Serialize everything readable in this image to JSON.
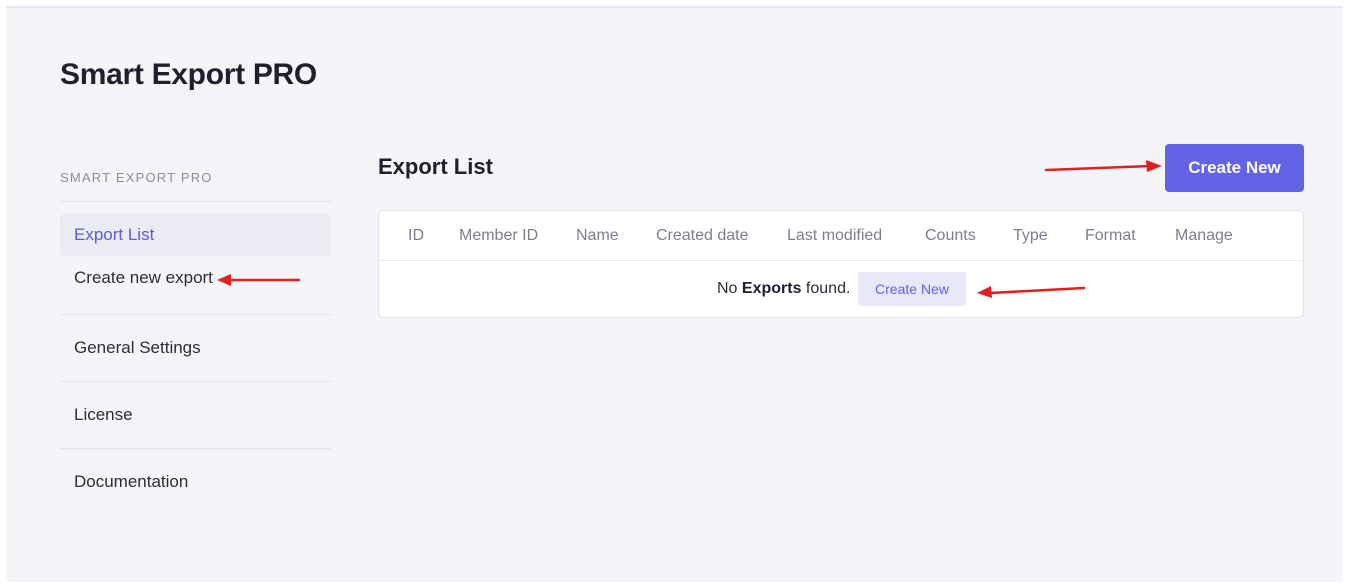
{
  "app": {
    "title": "Smart Export PRO"
  },
  "sidebar": {
    "heading": "SMART EXPORT PRO",
    "items": [
      {
        "label": "Export List"
      },
      {
        "label": "Create new export"
      },
      {
        "label": "General Settings"
      },
      {
        "label": "License"
      },
      {
        "label": "Documentation"
      }
    ]
  },
  "main": {
    "title": "Export List",
    "create_button": "Create New",
    "table": {
      "columns": [
        "ID",
        "Member ID",
        "Name",
        "Created date",
        "Last modified",
        "Counts",
        "Type",
        "Format",
        "Manage"
      ],
      "empty": {
        "prefix": "No ",
        "emphasis": "Exports",
        "suffix": " found.",
        "button": "Create New"
      }
    }
  },
  "colors": {
    "accent": "#6363e6",
    "annotation_arrow": "#e02020",
    "active_item_bg": "#ebebf4"
  }
}
